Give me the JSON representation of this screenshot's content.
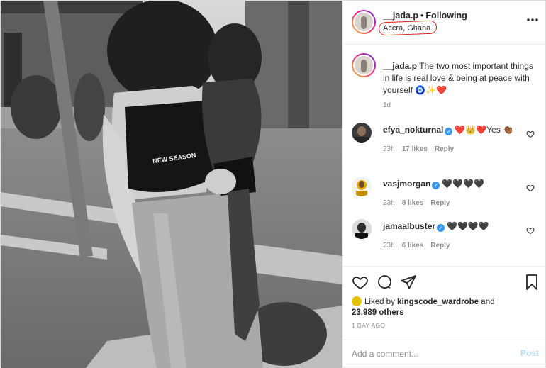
{
  "post": {
    "author": {
      "username": "__jada.p",
      "follow_status": "Following",
      "location": "Accra, Ghana"
    },
    "photo": {
      "top_text": "NEW SEASON",
      "alt": "Black-and-white photo of a woman holding and kissing a young child outdoors"
    },
    "caption": {
      "username": "__jada.p",
      "text": "The two most important things in life is real love & being at peace with yourself 🧿✨❤️",
      "age": "1d"
    },
    "comments": [
      {
        "username": "efya_nokturnal",
        "verified": true,
        "text": "❤️👑❤️Yes 👏🏾",
        "age": "23h",
        "likes": "17 likes",
        "reply": "Reply"
      },
      {
        "username": "vasjmorgan",
        "verified": true,
        "text": "🖤🖤🖤🖤",
        "age": "23h",
        "likes": "8 likes",
        "reply": "Reply"
      },
      {
        "username": "jamaalbuster",
        "verified": true,
        "text": "🖤🖤🖤🖤",
        "age": "23h",
        "likes": "6 likes",
        "reply": "Reply"
      }
    ],
    "liked_by": {
      "prefix": "Liked by",
      "user": "kingscode_wardrobe",
      "conjunction": "and",
      "others": "23,989 others"
    },
    "time_ago": "1 DAY AGO",
    "add_comment": {
      "placeholder": "Add a comment...",
      "post_label": "Post"
    },
    "icons": {
      "more": "more-horizontal-icon",
      "like": "heart-icon",
      "comment": "comment-bubble-icon",
      "share": "paper-plane-icon",
      "save": "bookmark-icon"
    },
    "colors": {
      "post_button": "#b2dffc",
      "verified": "#3897f0",
      "location_highlight": "#e0211b"
    }
  }
}
